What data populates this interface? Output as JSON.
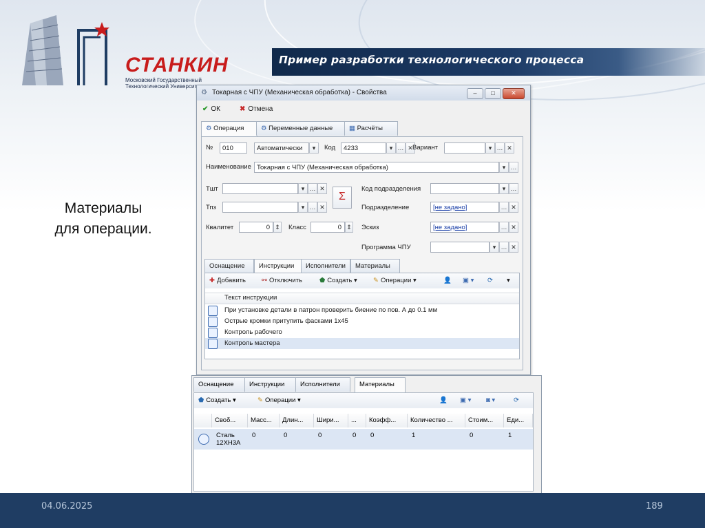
{
  "slide": {
    "title": "Пример разработки технологического процесса",
    "caption_line1": "Материалы",
    "caption_line2": "для операции.",
    "date": "04.06.2025",
    "page": "189"
  },
  "logo": {
    "name": "СТАНКИН",
    "subtitle": "Московский Государственный Технологический Университет"
  },
  "window": {
    "title": "Токарная с ЧПУ (Механическая обработка) - Свойства",
    "ok": "ОК",
    "cancel": "Отмена",
    "tabs": [
      "Операция",
      "Переменные данные",
      "Расчёты"
    ],
    "fields": {
      "num_label": "№",
      "num_value": "010",
      "mode_value": "Автоматически",
      "code_label": "Код",
      "code_value": "4233",
      "variant_label": "Вариант",
      "name_label": "Наименование",
      "name_value": "Токарная с ЧПУ (Механическая обработка)",
      "tsht_label": "Тшт",
      "tpz_label": "Тпз",
      "sigma": "Σ",
      "dept_code_label": "Код подразделения",
      "dept_label": "Подразделение",
      "dept_value": "[не задано]",
      "sketch_label": "Эскиз",
      "sketch_value": "[не задано]",
      "cnc_label": "Программа ЧПУ",
      "qual_label": "Квалитет",
      "qual_value": "0",
      "class_label": "Класс",
      "class_value": "0"
    },
    "subtabs": [
      "Оснащение",
      "Инструкции",
      "Исполнители",
      "Материалы"
    ],
    "toolbar": {
      "add": "Добавить",
      "disable": "Отключить",
      "create": "Создать",
      "operations": "Операции"
    },
    "grid_header": "Текст инструкции",
    "instructions": [
      "При установке детали в патрон проверить биение по пов. А до 0.1 мм",
      "Острые кромки притупить фасками 1х45",
      "Контроль рабочего",
      "Контроль мастера"
    ]
  },
  "materials_panel": {
    "tabs": [
      "Оснащение",
      "Инструкции",
      "Исполнители",
      "Материалы"
    ],
    "toolbar": {
      "create": "Создать",
      "operations": "Операции"
    },
    "columns": [
      "Своδ...",
      "Масс...",
      "Длин...",
      "Шири...",
      "...",
      "Коэфф...",
      "Количество ...",
      "Стоим...",
      "Еди..."
    ],
    "row": {
      "name_line1": "Сталь",
      "name_line2": "12ХН3А",
      "mass": "0",
      "length": "0",
      "width": "0",
      "extra": "0",
      "coef": "0",
      "qty": "1",
      "cost": "0",
      "unit": "1"
    }
  },
  "colors": {
    "title_bar": "#1d3b66",
    "bottom_band": "#1f3d63",
    "logo_red": "#c81c1c",
    "selection": "#dce6f4"
  }
}
